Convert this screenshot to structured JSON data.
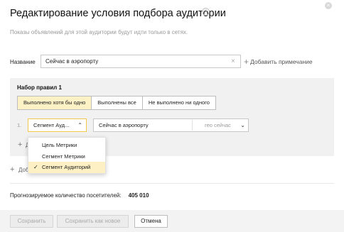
{
  "dialog": {
    "title": "Редактирование условия подбора аудитории",
    "subtitle": "Показы объявлений для этой аудитории будут идти только в сетях."
  },
  "name_field": {
    "label": "Название",
    "value": "Сейчас в аэропорту",
    "clear_icon": "×",
    "add_note_label": "Добавить примечание"
  },
  "rule_set": {
    "title": "Набор правил 1",
    "options": [
      {
        "label": "Выполнено хотя бы одно",
        "active": true
      },
      {
        "label": "Выполнены все",
        "active": false
      },
      {
        "label": "Не выполнено ни одного",
        "active": false
      }
    ],
    "row_number": "1.",
    "type_select_value": "Сегмент Ауд...",
    "value_select_value": "Сейчас в аэропорту",
    "value_hint": "гео сейчас",
    "add_rule_label": "Д",
    "add_set_label": "Доб"
  },
  "dropdown": {
    "items": [
      {
        "label": "Цель Метрики",
        "selected": false
      },
      {
        "label": "Сегмент Метрики",
        "selected": false
      },
      {
        "label": "Сегмент Аудиторий",
        "selected": true
      }
    ],
    "check_glyph": "✓"
  },
  "forecast": {
    "label": "Прогнозируемое количество посетителей:",
    "value": "405 010"
  },
  "footer": {
    "save_label": "Сохранить",
    "save_as_new_label": "Сохранить как новое",
    "cancel_label": "Отмена"
  },
  "colors": {
    "accent_yellow": "#f2c94c",
    "selected_bg": "#fdf1c6",
    "panel_bg": "#f1f1f1"
  },
  "icons": {
    "help": "question-circle-icon",
    "close": "close-icon",
    "plus": "plus-icon",
    "chevron": "chevron-down-icon",
    "check": "check-icon"
  }
}
